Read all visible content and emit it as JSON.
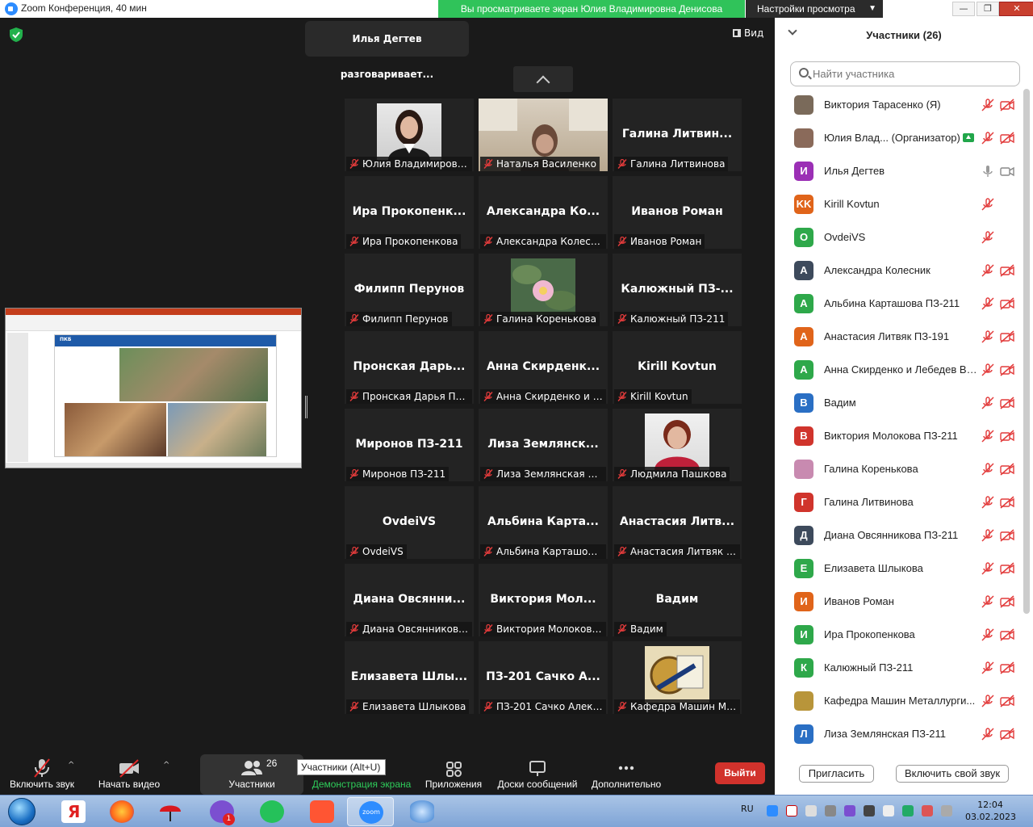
{
  "window": {
    "title": "Zoom Конференция, 40 мин",
    "share_banner": "Вы просматриваете экран Юлия Владимировна Денисова",
    "view_settings": "Настройки просмотра",
    "minimize": "—",
    "restore": "❐",
    "close": "✕"
  },
  "stage": {
    "speaking_now": "Илья Дегтев разговаривает...",
    "view_label": "Вид"
  },
  "tiles": [
    {
      "big": "",
      "label": "Юлия Владимировна...",
      "photo": "woman-portrait"
    },
    {
      "big": "",
      "label": "Наталья Василенко",
      "photo": "webcam-room"
    },
    {
      "big": "Галина  Литвин...",
      "label": "Галина Литвинова"
    },
    {
      "big": "Ира  Прокопенк...",
      "label": "Ира Прокопенкова"
    },
    {
      "big": "Александра  Ко...",
      "label": "Александра Колесник"
    },
    {
      "big": "Иванов Роман",
      "label": "Иванов Роман"
    },
    {
      "big": "Филипп Перунов",
      "label": "Филипп Перунов"
    },
    {
      "big": "",
      "label": "Галина Коренькова",
      "photo": "water-lily"
    },
    {
      "big": "Калюжный  ПЗ-...",
      "label": "Калюжный ПЗ-211"
    },
    {
      "big": "Пронская  Дарь...",
      "label": "Пронская Дарья ПЗ-..."
    },
    {
      "big": "Анна  Скирденк...",
      "label": "Анна Скирденко и Л..."
    },
    {
      "big": "Kirill Kovtun",
      "label": "Kirill Kovtun"
    },
    {
      "big": "Миронов ПЗ-211",
      "label": "Миронов ПЗ-211"
    },
    {
      "big": "Лиза  Землянск...",
      "label": "Лиза Землянская ПЗ..."
    },
    {
      "big": "",
      "label": "Людмила Пашкова",
      "photo": "woman-portrait-2"
    },
    {
      "big": "OvdeiVS",
      "label": "OvdeiVS"
    },
    {
      "big": "Альбина  Карта...",
      "label": "Альбина Карташова..."
    },
    {
      "big": "Анастасия  Литв...",
      "label": "Анастасия Литвяк ПЗ..."
    },
    {
      "big": "Диана  Овсянни...",
      "label": "Диана Овсянникова ..."
    },
    {
      "big": "Виктория  Мол...",
      "label": "Виктория Молокова ..."
    },
    {
      "big": "Вадим",
      "label": "Вадим"
    },
    {
      "big": "Елизавета  Шлы...",
      "label": "Елизавета Шлыкова"
    },
    {
      "big": "ПЗ-201 Сачко А...",
      "label": "ПЗ-201 Сачко Алекс..."
    },
    {
      "big": "",
      "label": "Кафедра Машин Ме...",
      "photo": "department-logo"
    }
  ],
  "toolbar": {
    "unmute": "Включить звук",
    "start_video": "Начать видео",
    "participants": "Участники",
    "participants_count": "26",
    "share_screen": "Демонстрация экрана",
    "apps": "Приложения",
    "whiteboards": "Доски сообщений",
    "more": "Дополнительно",
    "leave": "Выйти",
    "tooltip": "Участники (Alt+U)"
  },
  "panel": {
    "title": "Участники (26)",
    "search_placeholder": "Найти участника",
    "invite": "Пригласить",
    "unmute_self": "Включить свой звук",
    "participants": [
      {
        "initials": "",
        "name": "Виктория Тарасенко (Я)",
        "color": "#7a6a5a",
        "mic": "muted",
        "cam": "off",
        "avatar": "photo"
      },
      {
        "initials": "",
        "name": "Юлия Влад...  (Организатор)",
        "color": "#8a6a5a",
        "mic": "muted",
        "cam": "off",
        "avatar": "photo",
        "sharing": true
      },
      {
        "initials": "И",
        "name": "Илья Дегтев",
        "color": "#9b2fb5",
        "mic": "on",
        "cam": "on-off"
      },
      {
        "initials": "KK",
        "name": "Kirill Kovtun",
        "color": "#e0641a",
        "mic": "muted",
        "cam": "none"
      },
      {
        "initials": "O",
        "name": "OvdeiVS",
        "color": "#2ea84a",
        "mic": "muted",
        "cam": "none"
      },
      {
        "initials": "А",
        "name": "Александра Колесник",
        "color": "#3d4a5c",
        "mic": "muted",
        "cam": "off"
      },
      {
        "initials": "А",
        "name": "Альбина Карташова ПЗ-211",
        "color": "#2ea84a",
        "mic": "muted",
        "cam": "off"
      },
      {
        "initials": "А",
        "name": "Анастасия Литвяк ПЗ-191",
        "color": "#e0641a",
        "mic": "muted",
        "cam": "off"
      },
      {
        "initials": "А",
        "name": "Анна Скирденко и Лебедев Ви...",
        "color": "#2ea84a",
        "mic": "muted",
        "cam": "off"
      },
      {
        "initials": "В",
        "name": "Вадим",
        "color": "#2a6fc4",
        "mic": "muted",
        "cam": "off"
      },
      {
        "initials": "В",
        "name": "Виктория Молокова ПЗ-211",
        "color": "#d0342c",
        "mic": "muted",
        "cam": "off"
      },
      {
        "initials": "",
        "name": "Галина Коренькова",
        "color": "#c88ab0",
        "mic": "muted",
        "cam": "off",
        "avatar": "photo"
      },
      {
        "initials": "Г",
        "name": "Галина Литвинова",
        "color": "#d0342c",
        "mic": "muted",
        "cam": "off"
      },
      {
        "initials": "Д",
        "name": "Диана Овсянникова ПЗ-211",
        "color": "#3d4a5c",
        "mic": "muted",
        "cam": "off"
      },
      {
        "initials": "Е",
        "name": "Елизавета Шлыкова",
        "color": "#2ea84a",
        "mic": "muted",
        "cam": "off"
      },
      {
        "initials": "И",
        "name": "Иванов Роман",
        "color": "#e0641a",
        "mic": "muted",
        "cam": "off"
      },
      {
        "initials": "И",
        "name": "Ира Прокопенкова",
        "color": "#2ea84a",
        "mic": "muted",
        "cam": "off"
      },
      {
        "initials": "К",
        "name": "Калюжный ПЗ-211",
        "color": "#2ea84a",
        "mic": "muted",
        "cam": "off"
      },
      {
        "initials": "",
        "name": "Кафедра Машин Металлурги...",
        "color": "#b8953a",
        "mic": "muted",
        "cam": "off",
        "avatar": "photo"
      },
      {
        "initials": "Л",
        "name": "Лиза Землянская ПЗ-211",
        "color": "#2a6fc4",
        "mic": "muted",
        "cam": "off"
      }
    ]
  },
  "shared_slide": {
    "header": "ПКБ"
  },
  "taskbar": {
    "lang": "RU",
    "time": "12:04",
    "date": "03.02.2023",
    "viber_badge": "1",
    "zoom_label": "zoom",
    "apps": [
      "start-orb",
      "yandex-browser-icon",
      "firefox-icon",
      "umbrella-icon",
      "viber-icon",
      "whatsapp-icon",
      "camera-app-icon",
      "zoom-icon",
      "disk-icon"
    ]
  }
}
